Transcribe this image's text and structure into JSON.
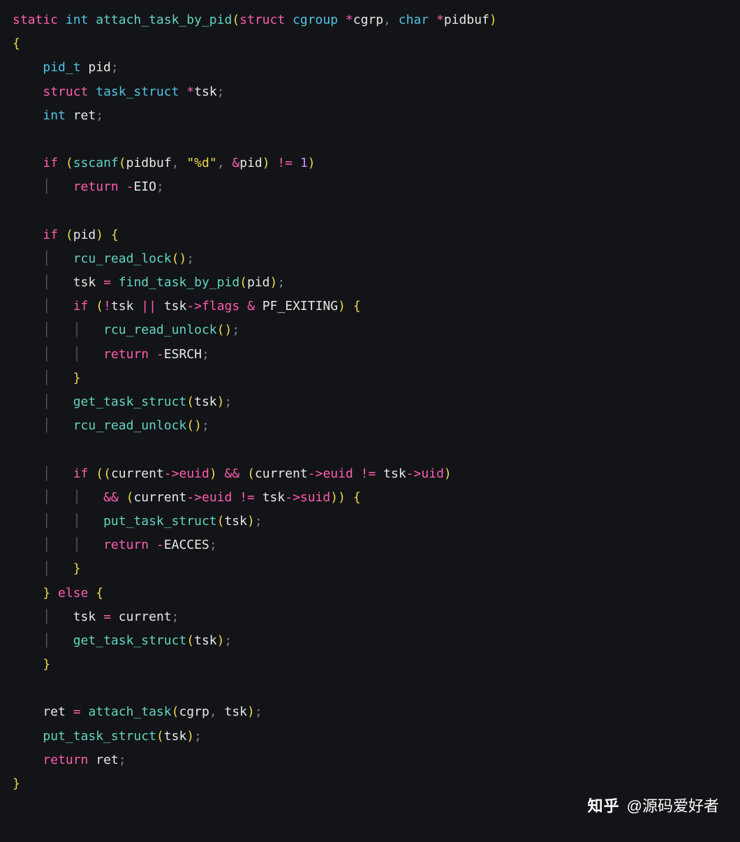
{
  "code": {
    "lines": [
      [
        [
          "k",
          "static"
        ],
        [
          "id",
          " "
        ],
        [
          "t",
          "int"
        ],
        [
          "id",
          " "
        ],
        [
          "fn",
          "attach_task_by_pid"
        ],
        [
          "p",
          "("
        ],
        [
          "k",
          "struct"
        ],
        [
          "id",
          " "
        ],
        [
          "t",
          "cgroup"
        ],
        [
          "id",
          " "
        ],
        [
          "op",
          "*"
        ],
        [
          "id",
          "cgrp"
        ],
        [
          "cm",
          ", "
        ],
        [
          "t",
          "char"
        ],
        [
          "id",
          " "
        ],
        [
          "op",
          "*"
        ],
        [
          "id",
          "pidbuf"
        ],
        [
          "p",
          ")"
        ]
      ],
      [
        [
          "p",
          "{"
        ]
      ],
      [
        [
          "id",
          "    "
        ],
        [
          "t",
          "pid_t"
        ],
        [
          "id",
          " pid"
        ],
        [
          "cm",
          ";"
        ]
      ],
      [
        [
          "id",
          "    "
        ],
        [
          "k",
          "struct"
        ],
        [
          "id",
          " "
        ],
        [
          "t",
          "task_struct"
        ],
        [
          "id",
          " "
        ],
        [
          "op",
          "*"
        ],
        [
          "id",
          "tsk"
        ],
        [
          "cm",
          ";"
        ]
      ],
      [
        [
          "id",
          "    "
        ],
        [
          "t",
          "int"
        ],
        [
          "id",
          " ret"
        ],
        [
          "cm",
          ";"
        ]
      ],
      [
        [
          "id",
          ""
        ]
      ],
      [
        [
          "id",
          "    "
        ],
        [
          "k",
          "if"
        ],
        [
          "id",
          " "
        ],
        [
          "p",
          "("
        ],
        [
          "fn",
          "sscanf"
        ],
        [
          "p",
          "("
        ],
        [
          "id",
          "pidbuf"
        ],
        [
          "cm",
          ", "
        ],
        [
          "s",
          "\"%d\""
        ],
        [
          "cm",
          ", "
        ],
        [
          "op",
          "&"
        ],
        [
          "id",
          "pid"
        ],
        [
          "p",
          ")"
        ],
        [
          "id",
          " "
        ],
        [
          "op",
          "!="
        ],
        [
          "id",
          " "
        ],
        [
          "n",
          "1"
        ],
        [
          "p",
          ")"
        ]
      ],
      [
        [
          "id",
          "    "
        ],
        [
          "g",
          "│   "
        ],
        [
          "k",
          "return"
        ],
        [
          "id",
          " "
        ],
        [
          "op",
          "-"
        ],
        [
          "c",
          "EIO"
        ],
        [
          "cm",
          ";"
        ]
      ],
      [
        [
          "id",
          ""
        ]
      ],
      [
        [
          "id",
          "    "
        ],
        [
          "k",
          "if"
        ],
        [
          "id",
          " "
        ],
        [
          "p",
          "("
        ],
        [
          "id",
          "pid"
        ],
        [
          "p",
          ")"
        ],
        [
          "id",
          " "
        ],
        [
          "p",
          "{"
        ]
      ],
      [
        [
          "id",
          "    "
        ],
        [
          "g",
          "│   "
        ],
        [
          "fn",
          "rcu_read_lock"
        ],
        [
          "p",
          "()"
        ],
        [
          "cm",
          ";"
        ]
      ],
      [
        [
          "id",
          "    "
        ],
        [
          "g",
          "│   "
        ],
        [
          "id",
          "tsk "
        ],
        [
          "op",
          "="
        ],
        [
          "id",
          " "
        ],
        [
          "fn",
          "find_task_by_pid"
        ],
        [
          "p",
          "("
        ],
        [
          "id",
          "pid"
        ],
        [
          "p",
          ")"
        ],
        [
          "cm",
          ";"
        ]
      ],
      [
        [
          "id",
          "    "
        ],
        [
          "g",
          "│   "
        ],
        [
          "k",
          "if"
        ],
        [
          "id",
          " "
        ],
        [
          "p",
          "("
        ],
        [
          "op",
          "!"
        ],
        [
          "id",
          "tsk "
        ],
        [
          "op",
          "||"
        ],
        [
          "id",
          " tsk"
        ],
        [
          "op",
          "->"
        ],
        [
          "mem",
          "flags"
        ],
        [
          "id",
          " "
        ],
        [
          "op",
          "&"
        ],
        [
          "id",
          " PF_EXITING"
        ],
        [
          "p",
          ")"
        ],
        [
          "id",
          " "
        ],
        [
          "p",
          "{"
        ]
      ],
      [
        [
          "id",
          "    "
        ],
        [
          "g",
          "│   │   "
        ],
        [
          "fn",
          "rcu_read_unlock"
        ],
        [
          "p",
          "()"
        ],
        [
          "cm",
          ";"
        ]
      ],
      [
        [
          "id",
          "    "
        ],
        [
          "g",
          "│   │   "
        ],
        [
          "k",
          "return"
        ],
        [
          "id",
          " "
        ],
        [
          "op",
          "-"
        ],
        [
          "c",
          "ESRCH"
        ],
        [
          "cm",
          ";"
        ]
      ],
      [
        [
          "id",
          "    "
        ],
        [
          "g",
          "│   "
        ],
        [
          "p",
          "}"
        ]
      ],
      [
        [
          "id",
          "    "
        ],
        [
          "g",
          "│   "
        ],
        [
          "fn",
          "get_task_struct"
        ],
        [
          "p",
          "("
        ],
        [
          "id",
          "tsk"
        ],
        [
          "p",
          ")"
        ],
        [
          "cm",
          ";"
        ]
      ],
      [
        [
          "id",
          "    "
        ],
        [
          "g",
          "│   "
        ],
        [
          "fn",
          "rcu_read_unlock"
        ],
        [
          "p",
          "()"
        ],
        [
          "cm",
          ";"
        ]
      ],
      [
        [
          "id",
          ""
        ]
      ],
      [
        [
          "id",
          "    "
        ],
        [
          "g",
          "│   "
        ],
        [
          "k",
          "if"
        ],
        [
          "id",
          " "
        ],
        [
          "p",
          "(("
        ],
        [
          "id",
          "current"
        ],
        [
          "op",
          "->"
        ],
        [
          "mem",
          "euid"
        ],
        [
          "p",
          ")"
        ],
        [
          "id",
          " "
        ],
        [
          "op",
          "&&"
        ],
        [
          "id",
          " "
        ],
        [
          "p",
          "("
        ],
        [
          "id",
          "current"
        ],
        [
          "op",
          "->"
        ],
        [
          "mem",
          "euid"
        ],
        [
          "id",
          " "
        ],
        [
          "op",
          "!="
        ],
        [
          "id",
          " tsk"
        ],
        [
          "op",
          "->"
        ],
        [
          "mem",
          "uid"
        ],
        [
          "p",
          ")"
        ]
      ],
      [
        [
          "id",
          "    "
        ],
        [
          "g",
          "│   │   "
        ],
        [
          "op",
          "&&"
        ],
        [
          "id",
          " "
        ],
        [
          "p",
          "("
        ],
        [
          "id",
          "current"
        ],
        [
          "op",
          "->"
        ],
        [
          "mem",
          "euid"
        ],
        [
          "id",
          " "
        ],
        [
          "op",
          "!="
        ],
        [
          "id",
          " tsk"
        ],
        [
          "op",
          "->"
        ],
        [
          "mem",
          "suid"
        ],
        [
          "p",
          "))"
        ],
        [
          "id",
          " "
        ],
        [
          "p",
          "{"
        ]
      ],
      [
        [
          "id",
          "    "
        ],
        [
          "g",
          "│   │   "
        ],
        [
          "fn",
          "put_task_struct"
        ],
        [
          "p",
          "("
        ],
        [
          "id",
          "tsk"
        ],
        [
          "p",
          ")"
        ],
        [
          "cm",
          ";"
        ]
      ],
      [
        [
          "id",
          "    "
        ],
        [
          "g",
          "│   │   "
        ],
        [
          "k",
          "return"
        ],
        [
          "id",
          " "
        ],
        [
          "op",
          "-"
        ],
        [
          "c",
          "EACCES"
        ],
        [
          "cm",
          ";"
        ]
      ],
      [
        [
          "id",
          "    "
        ],
        [
          "g",
          "│   "
        ],
        [
          "p",
          "}"
        ]
      ],
      [
        [
          "id",
          "    "
        ],
        [
          "p",
          "}"
        ],
        [
          "id",
          " "
        ],
        [
          "k",
          "else"
        ],
        [
          "id",
          " "
        ],
        [
          "p",
          "{"
        ]
      ],
      [
        [
          "id",
          "    "
        ],
        [
          "g",
          "│   "
        ],
        [
          "id",
          "tsk "
        ],
        [
          "op",
          "="
        ],
        [
          "id",
          " current"
        ],
        [
          "cm",
          ";"
        ]
      ],
      [
        [
          "id",
          "    "
        ],
        [
          "g",
          "│   "
        ],
        [
          "fn",
          "get_task_struct"
        ],
        [
          "p",
          "("
        ],
        [
          "id",
          "tsk"
        ],
        [
          "p",
          ")"
        ],
        [
          "cm",
          ";"
        ]
      ],
      [
        [
          "id",
          "    "
        ],
        [
          "p",
          "}"
        ]
      ],
      [
        [
          "id",
          ""
        ]
      ],
      [
        [
          "id",
          "    ret "
        ],
        [
          "op",
          "="
        ],
        [
          "id",
          " "
        ],
        [
          "fn",
          "attach_task"
        ],
        [
          "p",
          "("
        ],
        [
          "id",
          "cgrp"
        ],
        [
          "cm",
          ", "
        ],
        [
          "id",
          "tsk"
        ],
        [
          "p",
          ")"
        ],
        [
          "cm",
          ";"
        ]
      ],
      [
        [
          "id",
          "    "
        ],
        [
          "fn",
          "put_task_struct"
        ],
        [
          "p",
          "("
        ],
        [
          "id",
          "tsk"
        ],
        [
          "p",
          ")"
        ],
        [
          "cm",
          ";"
        ]
      ],
      [
        [
          "id",
          "    "
        ],
        [
          "k",
          "return"
        ],
        [
          "id",
          " ret"
        ],
        [
          "cm",
          ";"
        ]
      ],
      [
        [
          "p",
          "}"
        ]
      ]
    ]
  },
  "watermark": {
    "logo": "知乎",
    "author": "@源码爱好者"
  }
}
